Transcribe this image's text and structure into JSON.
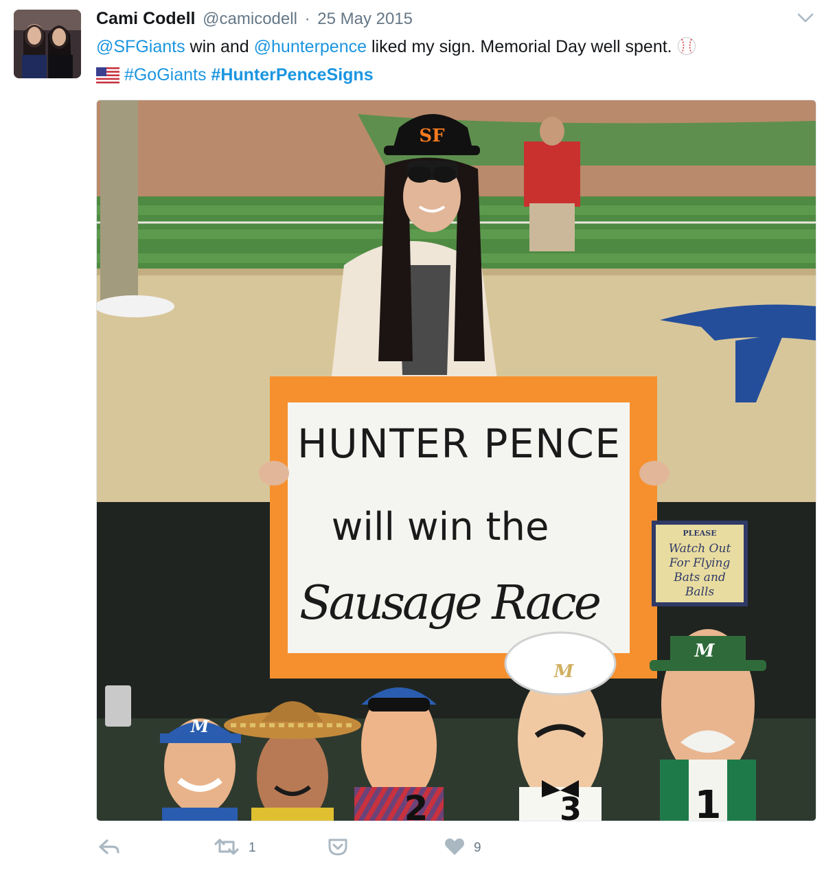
{
  "tweet": {
    "author": {
      "display_name": "Cami Codell",
      "screen_name": "@camicodell",
      "separator": "·",
      "timestamp": "25 May 2015"
    },
    "text": {
      "mention_1": "@SFGiants",
      "segment_1": " win and ",
      "mention_2": "@hunterpence",
      "segment_2": " liked my sign. Memorial Day well spent. ",
      "hashtag_1": "#GoGiants",
      "hashtag_2": "#HunterPenceSigns"
    },
    "media": {
      "sign_line_1": "HUNTER PENCE",
      "sign_line_2": "will win the",
      "sign_line_3": "Sausage Race",
      "cap_logo": "SF",
      "dugout_sign": [
        "PLEASE",
        "Watch Out",
        "For Flying",
        "Bats and",
        "Balls"
      ],
      "mascot_numbers": [
        "2",
        "3",
        "1"
      ],
      "mascot_cap_letter": "M"
    },
    "actions": {
      "retweet_count": "1",
      "like_count": "9"
    },
    "colors": {
      "link": "#1b95e0",
      "meta": "#657786",
      "text": "#14171a",
      "icon": "#aab8c2"
    }
  }
}
